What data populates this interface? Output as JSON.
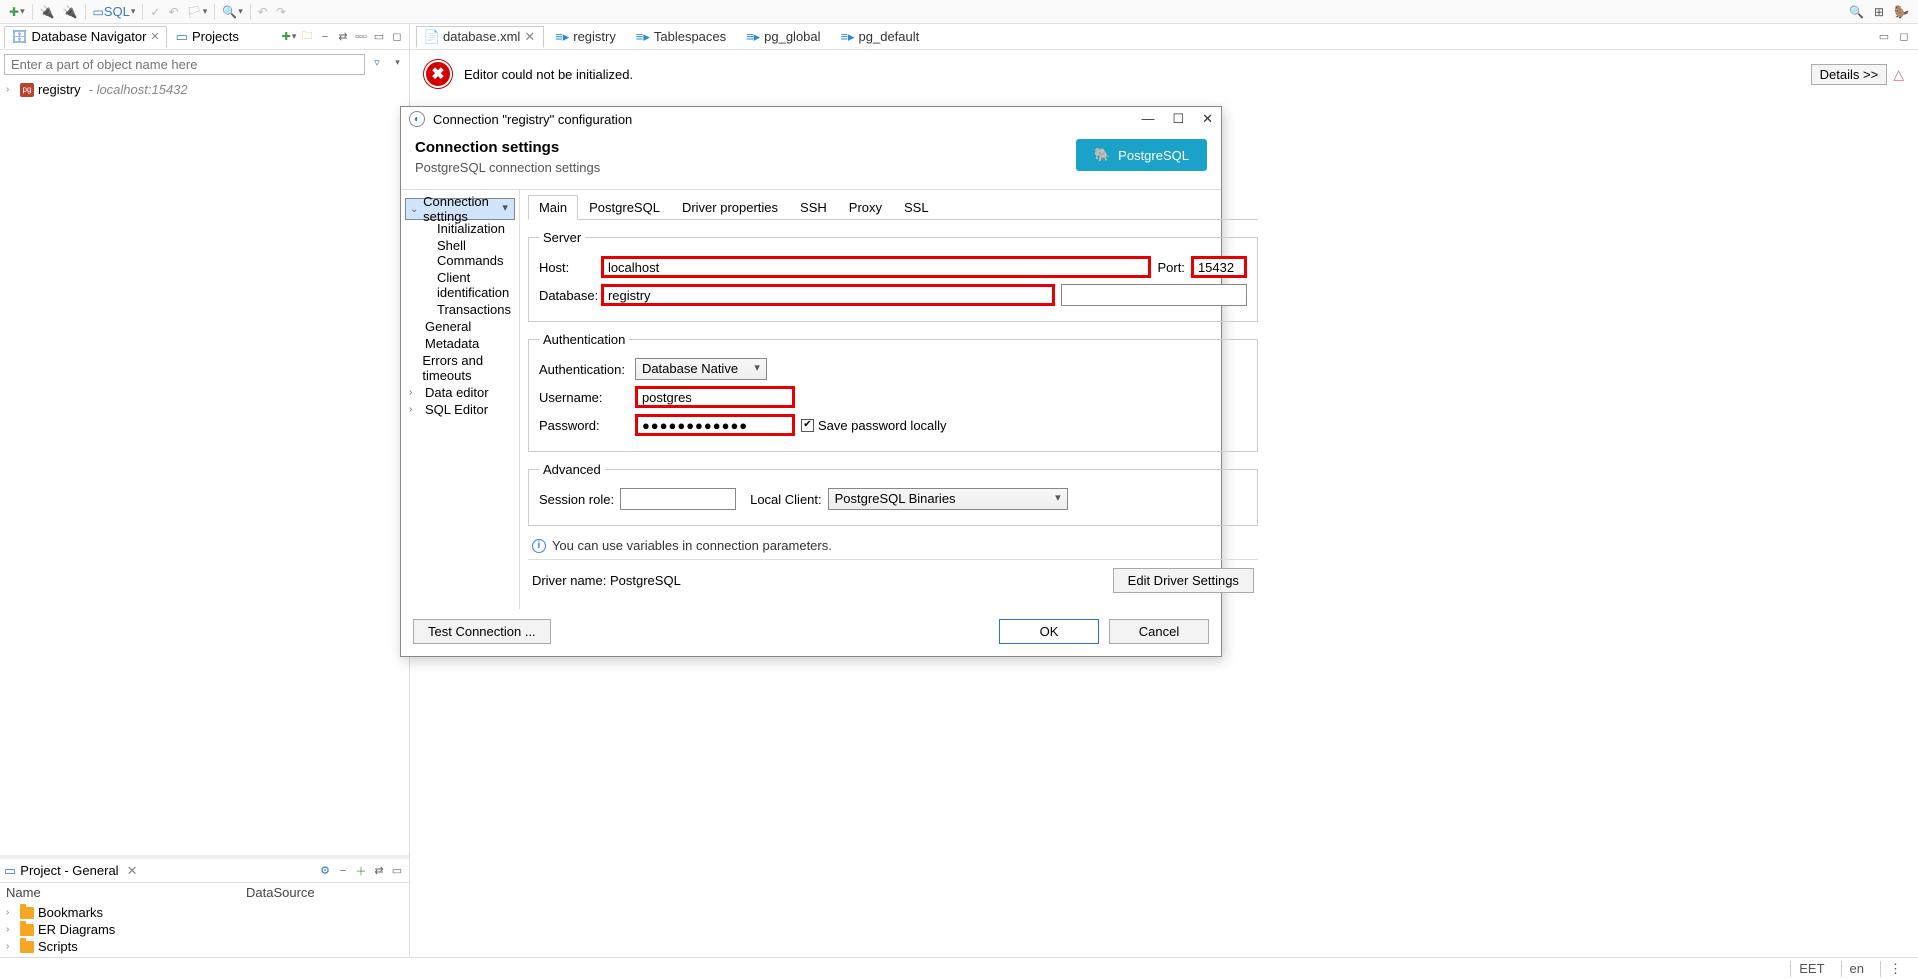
{
  "toolbar": {
    "sql_label": "SQL"
  },
  "nav": {
    "tabs": {
      "db": "Database Navigator",
      "projects": "Projects"
    },
    "filter_placeholder": "Enter a part of object name here",
    "tree": {
      "name": "registry",
      "sub": "- localhost:15432"
    }
  },
  "project_panel": {
    "title": "Project - General",
    "cols": {
      "name": "Name",
      "ds": "DataSource"
    },
    "items": [
      "Bookmarks",
      "ER Diagrams",
      "Scripts"
    ]
  },
  "editor": {
    "tabs": [
      "database.xml",
      "registry",
      "Tablespaces",
      "pg_global",
      "pg_default"
    ],
    "error": "Editor could not be initialized.",
    "details": "Details >>"
  },
  "dialog": {
    "title": "Connection \"registry\" configuration",
    "h1": "Connection settings",
    "h2": "PostgreSQL connection settings",
    "pg_brand": "PostgreSQL",
    "nav": {
      "conn_settings": "Connection settings",
      "init": "Initialization",
      "shell": "Shell Commands",
      "client_id": "Client identification",
      "trans": "Transactions",
      "general": "General",
      "metadata": "Metadata",
      "errors": "Errors and timeouts",
      "data_editor": "Data editor",
      "sql_editor": "SQL Editor"
    },
    "tabs": [
      "Main",
      "PostgreSQL",
      "Driver properties",
      "SSH",
      "Proxy",
      "SSL"
    ],
    "server": {
      "legend": "Server",
      "host_label": "Host:",
      "host_value": "localhost",
      "port_label": "Port:",
      "port_value": "15432",
      "db_label": "Database:",
      "db_value": "registry"
    },
    "auth": {
      "legend": "Authentication",
      "auth_label": "Authentication:",
      "auth_value": "Database Native",
      "user_label": "Username:",
      "user_value": "postgres",
      "pass_label": "Password:",
      "pass_value": "●●●●●●●●●●●●",
      "save_label": "Save password locally"
    },
    "adv": {
      "legend": "Advanced",
      "role_label": "Session role:",
      "role_value": "",
      "client_label": "Local Client:",
      "client_value": "PostgreSQL Binaries"
    },
    "info": "You can use variables in connection parameters.",
    "driver_label": "Driver name:",
    "driver_value": "PostgreSQL",
    "edit_driver": "Edit Driver Settings",
    "test": "Test Connection ...",
    "ok": "OK",
    "cancel": "Cancel"
  },
  "status": {
    "tz": "EET",
    "lang": "en"
  }
}
